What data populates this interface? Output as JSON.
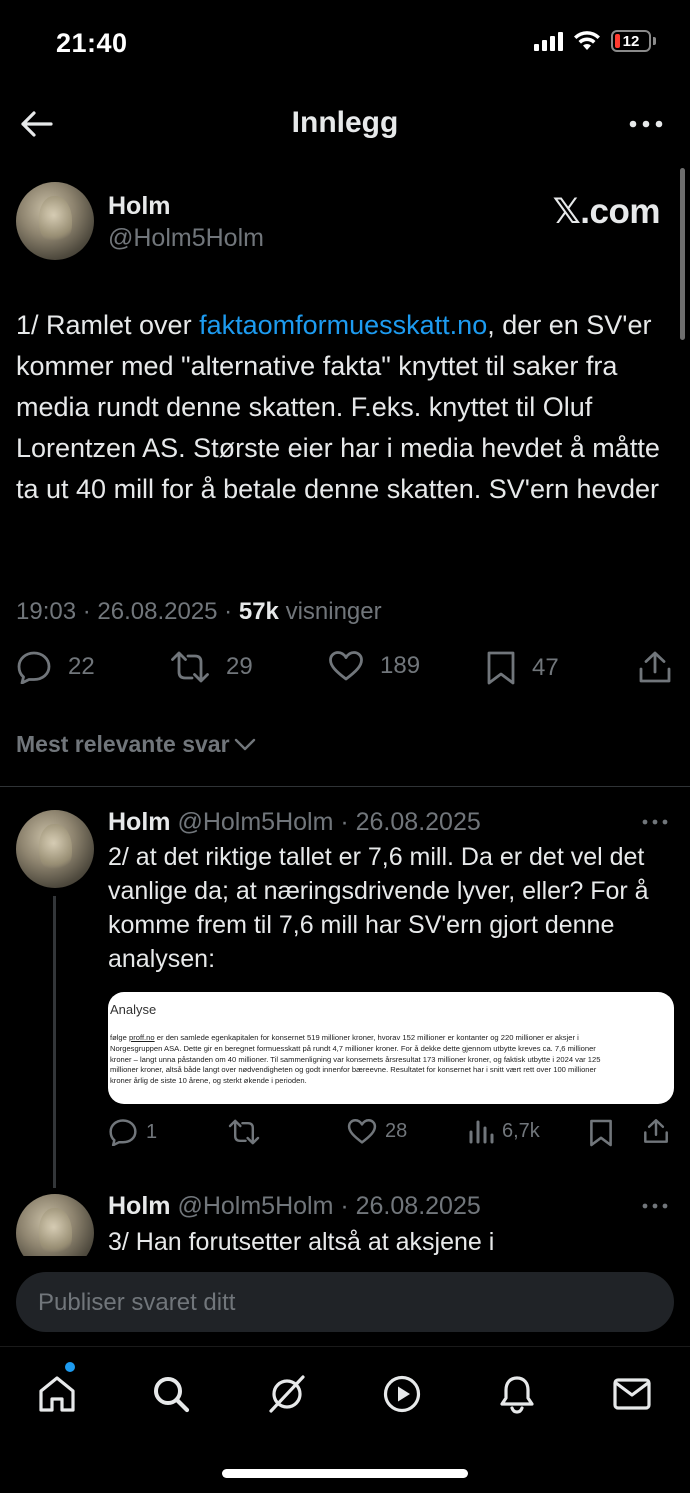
{
  "status_bar": {
    "time": "21:40",
    "battery": "12"
  },
  "nav": {
    "title": "Innlegg"
  },
  "main_post": {
    "author_name": "Holm",
    "author_handle": "@Holm5Holm",
    "badge": "𝕏.com",
    "text_prefix": "1/ Ramlet over ",
    "link": "faktaomformuesskatt.no",
    "text_suffix": ", der en SV'er kommer med \"alternative fakta\" knyttet til saker fra media rundt denne skatten. F.eks. knyttet til Oluf Lorentzen AS. Største eier har i media hevdet å måtte ta ut 40 mill for å betale denne skatten. SV'ern hevder",
    "time": "19:03",
    "date": "26.08.2025",
    "views_count": "57k",
    "views_label": "visninger",
    "stats": {
      "replies": "22",
      "reposts": "29",
      "likes": "189",
      "bookmarks": "47"
    }
  },
  "sort_label": "Mest relevante svar",
  "replies": [
    {
      "author_name": "Holm",
      "meta": "@Holm5Holm · 26.08.2025",
      "text": "2/ at det riktige tallet er 7,6 mill. Da er det vel det vanlige da; at næringsdrivende lyver, eller? For å komme frem til 7,6 mill har SV'ern gjort denne analysen:",
      "media": {
        "title": "Analyse",
        "line1_prefix": "følge ",
        "line1_link": "proff.no",
        "line1_rest": " er den samlede egenkapitalen for konsernet 519 millioner kroner, hvorav 152 millioner er kontanter og 220 millioner er aksjer i",
        "line2": "Norgesgruppen ASA. Dette gir en beregnet formuesskatt på rundt 4,7 millioner kroner. For å dekke dette gjennom utbytte kreves ca. 7,6 millioner",
        "line3": "kroner – langt unna påstanden om 40 millioner. Til sammenligning var konsernets årsresultat 173 millioner kroner, og faktisk utbytte i 2024 var 125",
        "line4": "millioner kroner, altså både langt over nødvendigheten og godt innenfor bæreevne. Resultatet for konsernet har i snitt vært rett over 100 millioner",
        "line5": "kroner årlig de siste 10 årene, og sterkt økende i perioden."
      },
      "stats": {
        "replies": "1",
        "reposts": "",
        "likes": "28",
        "views": "6,7k"
      }
    },
    {
      "author_name": "Holm",
      "meta": "@Holm5Holm · 26.08.2025",
      "text": "3/ Han forutsetter altså at aksjene i"
    }
  ],
  "compose": {
    "placeholder": "Publiser svaret ditt"
  },
  "colors": {
    "accent": "#1d9bf0",
    "background": "#000000",
    "muted": "#71767b",
    "text": "#e7e9ea"
  },
  "tabs": [
    "home-icon",
    "search-icon",
    "grok-icon",
    "video-icon",
    "notifications-icon",
    "messages-icon"
  ]
}
